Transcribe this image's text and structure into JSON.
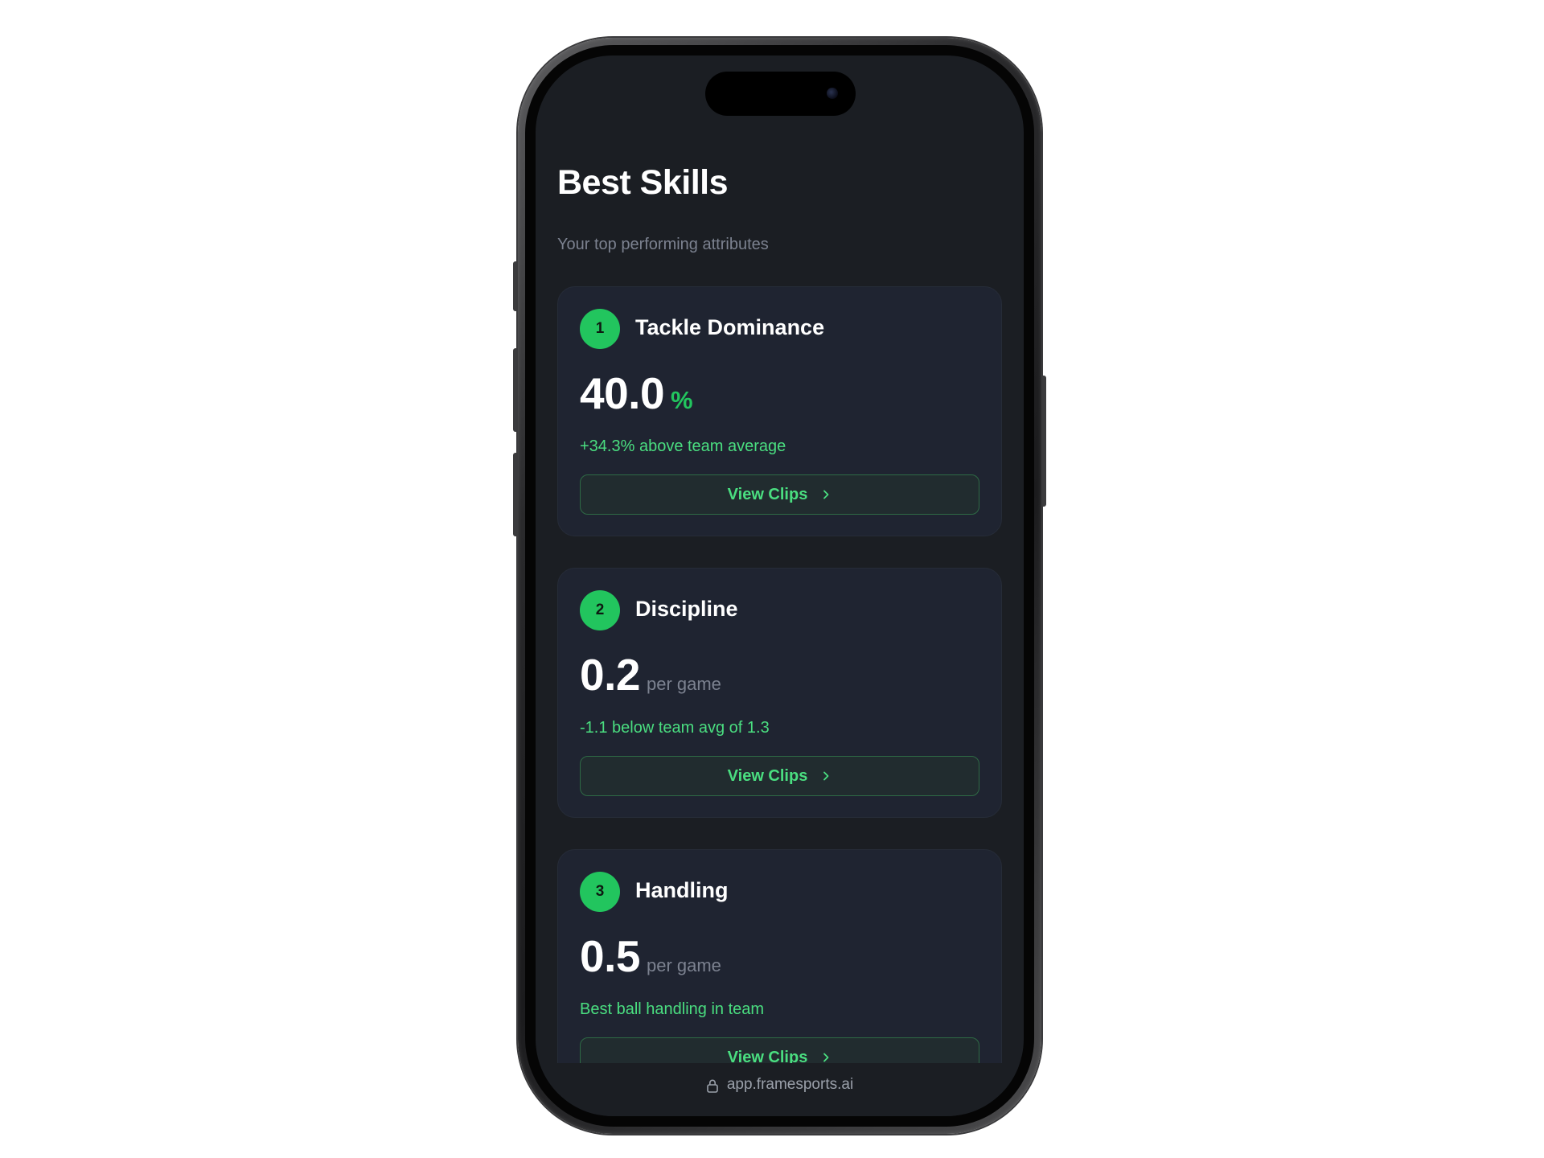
{
  "header": {
    "title": "Best Skills",
    "subtitle": "Your top performing attributes"
  },
  "skills": [
    {
      "rank": "1",
      "name": "Tackle Dominance",
      "value": "40.0",
      "unit": "%",
      "comparison": "+34.3% above team average",
      "button_label": "View Clips"
    },
    {
      "rank": "2",
      "name": "Discipline",
      "value": "0.2",
      "unit": "per game",
      "comparison": "-1.1 below team avg of 1.3",
      "button_label": "View Clips"
    },
    {
      "rank": "3",
      "name": "Handling",
      "value": "0.5",
      "unit": "per game",
      "comparison": "Best ball handling in team",
      "button_label": "View Clips"
    }
  ],
  "browser": {
    "url": "app.framesports.ai",
    "url_icon": "lock-icon"
  },
  "theme": {
    "accent": "#22c55e",
    "accent_text": "#4ade80",
    "background": "#1b1e23",
    "card": "#1f2431"
  }
}
